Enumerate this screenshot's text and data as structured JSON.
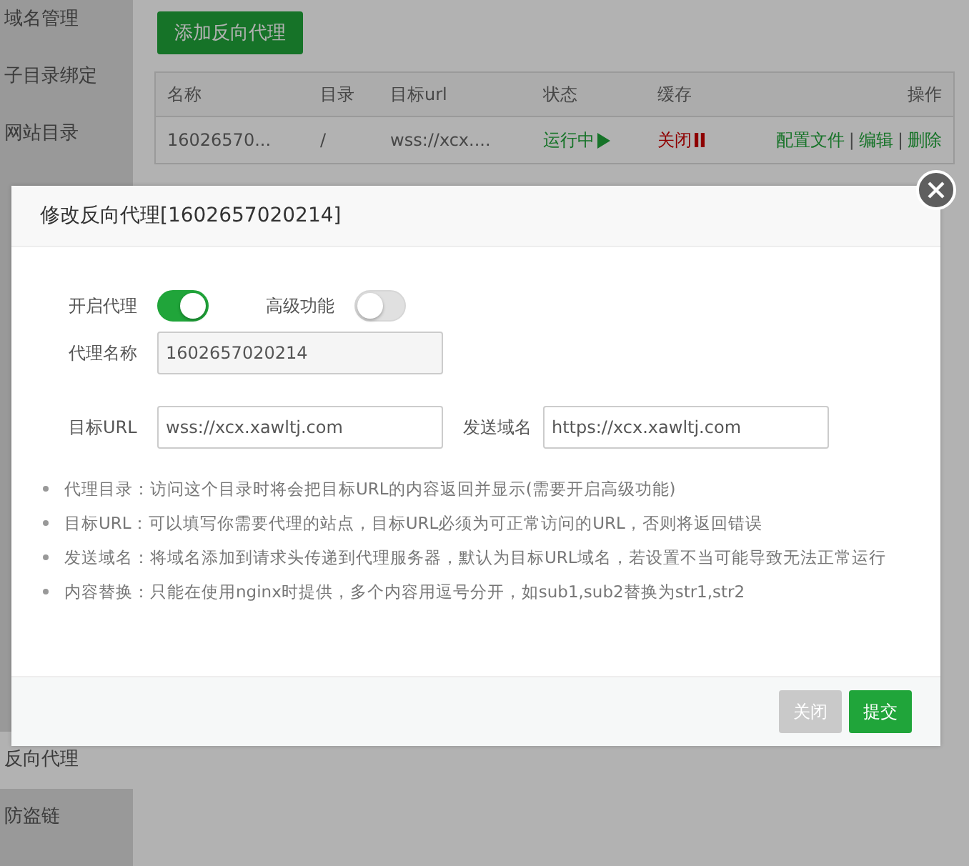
{
  "sidebar": {
    "top_items": [
      {
        "label": "域名管理",
        "selected": false
      },
      {
        "label": "子目录绑定",
        "selected": false
      },
      {
        "label": "网站目录",
        "selected": false
      }
    ],
    "bottom_items": [
      {
        "label": "反向代理",
        "selected": true
      },
      {
        "label": "防盗链",
        "selected": false
      }
    ]
  },
  "add_button": "添加反向代理",
  "table": {
    "columns": [
      "名称",
      "目录",
      "目标url",
      "状态",
      "缓存",
      "操作"
    ],
    "rows": [
      {
        "name": "16026570...",
        "directory": "/",
        "target_url": "wss://xcx....",
        "status": {
          "text": "运行中",
          "on": true
        },
        "cache": {
          "text": "关闭",
          "on": false
        },
        "actions": [
          "配置文件",
          "编辑",
          "删除"
        ],
        "separator": "|"
      }
    ]
  },
  "dialog": {
    "title": "修改反向代理[1602657020214]",
    "toggles": [
      {
        "label": "开启代理",
        "on": true
      },
      {
        "label": "高级功能",
        "on": false
      }
    ],
    "name_field": {
      "label": "代理名称",
      "value": "1602657020214"
    },
    "target_field": {
      "label": "目标URL",
      "value": "wss://xcx.xawltj.com"
    },
    "host_field": {
      "label": "发送域名",
      "value": "https://xcx.xawltj.com"
    },
    "notes": [
      "代理目录：访问这个目录时将会把目标URL的内容返回并显示(需要开启高级功能)",
      "目标URL：可以填写你需要代理的站点，目标URL必须为可正常访问的URL，否则将返回错误",
      "发送域名：将域名添加到请求头传递到代理服务器，默认为目标URL域名，若设置不当可能导致无法正常运行",
      "内容替换：只能在使用nginx时提供，多个内容用逗号分开，如sub1,sub2替换为str1,str2"
    ],
    "buttons": [
      {
        "label": "关闭",
        "kind": "secondary"
      },
      {
        "label": "提交",
        "kind": "primary"
      }
    ]
  }
}
